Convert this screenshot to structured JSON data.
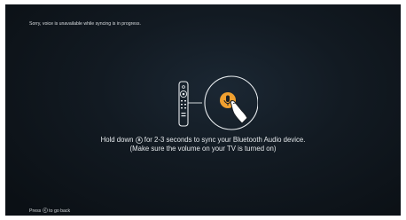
{
  "status": {
    "message": "Sorry, voice is unavailable while syncing is in progress."
  },
  "illustration": {
    "remote_icon": "fire-tv-remote-icon",
    "mic_icon": "microphone-button-icon",
    "hand_icon": "finger-press-icon",
    "accent_color": "#f0a030"
  },
  "instruction": {
    "line1_before": "Hold down",
    "line1_icon": "microphone-icon",
    "line1_after": "for 2-3 seconds to sync your Bluetooth Audio device.",
    "line2": "(Make sure the volume on your TV is turned on)"
  },
  "footer": {
    "before": "Press",
    "icon": "back-button-icon",
    "after": "to go back"
  }
}
